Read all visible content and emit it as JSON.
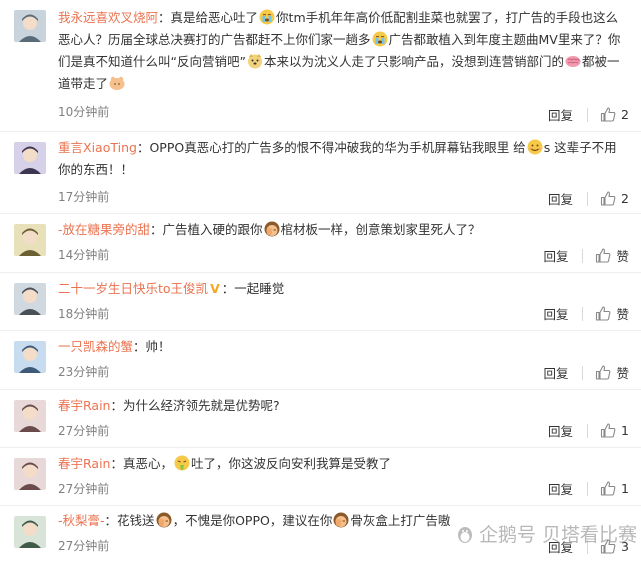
{
  "comments": [
    {
      "user": "我永远喜欢叉烧阿",
      "segments": [
        {
          "t": "text",
          "v": "真是给恶心吐了"
        },
        {
          "t": "emo",
          "v": "cry-face-emoji"
        },
        {
          "t": "text",
          "v": "你tm手机年年高价低配割韭菜也就罢了，打广告的手段也这么恶心人？历届全球总决赛打的广告都赶不上你们家一趟多"
        },
        {
          "t": "emo",
          "v": "cry-face-emoji"
        },
        {
          "t": "text",
          "v": "广告都敢植入到年度主题曲MV里来了？你们是真不知道什么叫“反向营销吧”"
        },
        {
          "t": "emo",
          "v": "doge-emoji"
        },
        {
          "t": "text",
          "v": "本来以为沈义人走了只影响产品，没想到连营销部门的"
        },
        {
          "t": "emo",
          "v": "brain-emoji"
        },
        {
          "t": "text",
          "v": "都被一道带走了"
        },
        {
          "t": "emo",
          "v": "bow-emoji"
        }
      ],
      "time": "10分钟前",
      "reply": "回复",
      "likes": "2"
    },
    {
      "user": "重言XiaoTing",
      "segments": [
        {
          "t": "text",
          "v": "OPPO真恶心打的广告多的恨不得冲破我的华为手机屏幕钻我眼里  给"
        },
        {
          "t": "emo",
          "v": "smile-emoji"
        },
        {
          "t": "text",
          "v": "s 这辈子不用你的东西！！"
        }
      ],
      "time": "17分钟前",
      "reply": "回复",
      "likes": "2"
    },
    {
      "user": "-放在糖果旁的甜",
      "segments": [
        {
          "t": "text",
          "v": "广告植入硬的跟你"
        },
        {
          "t": "emo",
          "v": "face-palm-emoji"
        },
        {
          "t": "text",
          "v": "棺材板一样，创意策划家里死人了？"
        }
      ],
      "time": "14分钟前",
      "reply": "回复",
      "likes": "赞"
    },
    {
      "user": "二十一岁生日快乐to王俊凯",
      "badge": "V",
      "segments": [
        {
          "t": "text",
          "v": "一起睡觉"
        }
      ],
      "time": "18分钟前",
      "reply": "回复",
      "likes": "赞"
    },
    {
      "user": "一只凯森的蟹",
      "segments": [
        {
          "t": "text",
          "v": "帅！"
        }
      ],
      "time": "23分钟前",
      "reply": "回复",
      "likes": "赞"
    },
    {
      "user": "春宇Rain",
      "segments": [
        {
          "t": "text",
          "v": "为什么经济领先就是优势呢?"
        }
      ],
      "time": "27分钟前",
      "reply": "回复",
      "likes": "1"
    },
    {
      "user": "春宇Rain",
      "segments": [
        {
          "t": "text",
          "v": "真恶心，"
        },
        {
          "t": "emo",
          "v": "vomit-emoji"
        },
        {
          "t": "text",
          "v": "吐了，你这波反向安利我算是受教了"
        }
      ],
      "time": "27分钟前",
      "reply": "回复",
      "likes": "1"
    },
    {
      "user": "-秋梨膏-",
      "segments": [
        {
          "t": "text",
          "v": "花钱送"
        },
        {
          "t": "emo",
          "v": "face-palm-emoji"
        },
        {
          "t": "text",
          "v": "，不愧是你OPPO，建议在你"
        },
        {
          "t": "emo",
          "v": "face-palm-emoji"
        },
        {
          "t": "text",
          "v": "骨灰盒上打广告嗷"
        }
      ],
      "time": "27分钟前",
      "reply": "回复",
      "likes": "3"
    }
  ],
  "watermark": "企鹅号 贝塔看比赛",
  "colors": {
    "username": "#eb7350",
    "time": "#808080",
    "text": "#333333",
    "badge": "#f5a623"
  }
}
